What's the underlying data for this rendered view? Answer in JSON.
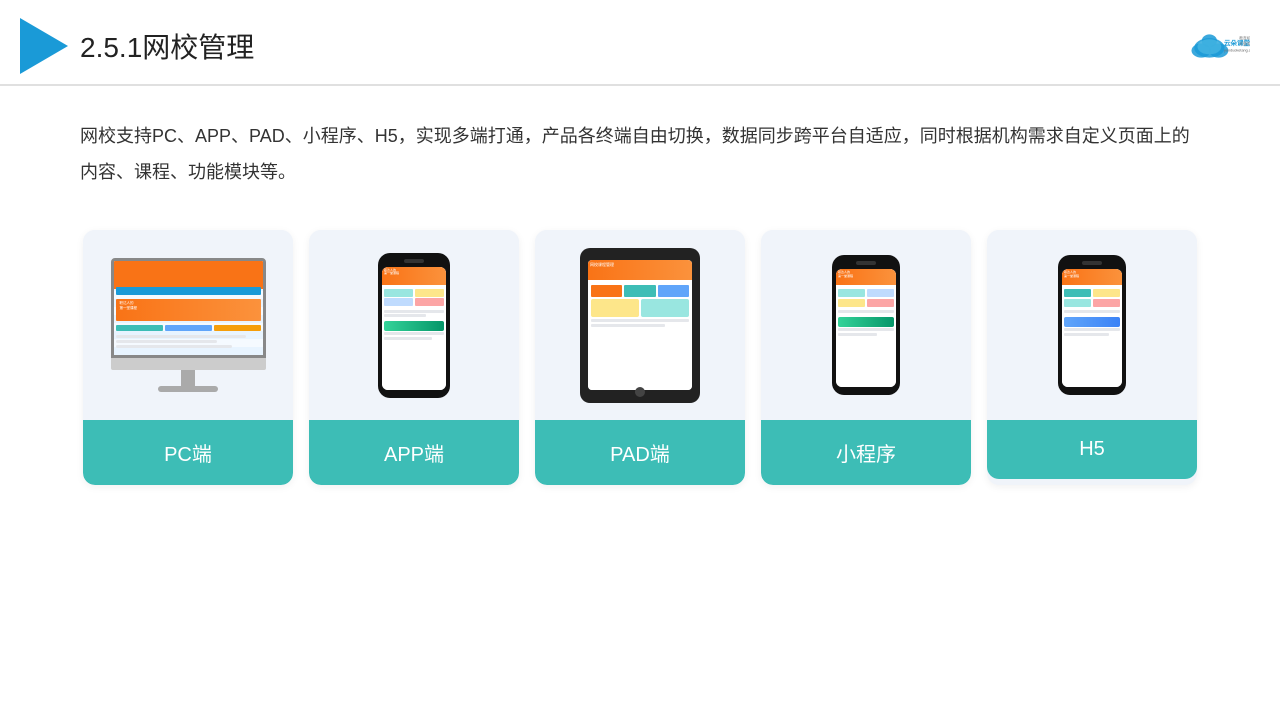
{
  "header": {
    "title_prefix": "2.5.1",
    "title_main": "网校管理"
  },
  "logo": {
    "brand": "云朵课堂",
    "url": "yunduoketang.com",
    "tagline": "教育机构一站\n式服务云平台"
  },
  "description": {
    "text": "网校支持PC、APP、PAD、小程序、H5，实现多端打通，产品各终端自由切换，数据同步跨平台自适应，同时根据机构需求自定义页面上的内容、课程、功能模块等。"
  },
  "cards": [
    {
      "id": "pc",
      "label": "PC端"
    },
    {
      "id": "app",
      "label": "APP端"
    },
    {
      "id": "pad",
      "label": "PAD端"
    },
    {
      "id": "miniprogram",
      "label": "小程序"
    },
    {
      "id": "h5",
      "label": "H5"
    }
  ],
  "colors": {
    "accent": "#3dbdb6",
    "header_border": "#e0e0e0",
    "play_icon": "#1a9ad7",
    "card_bg": "#f0f4fa",
    "text_primary": "#222",
    "text_body": "#333"
  }
}
